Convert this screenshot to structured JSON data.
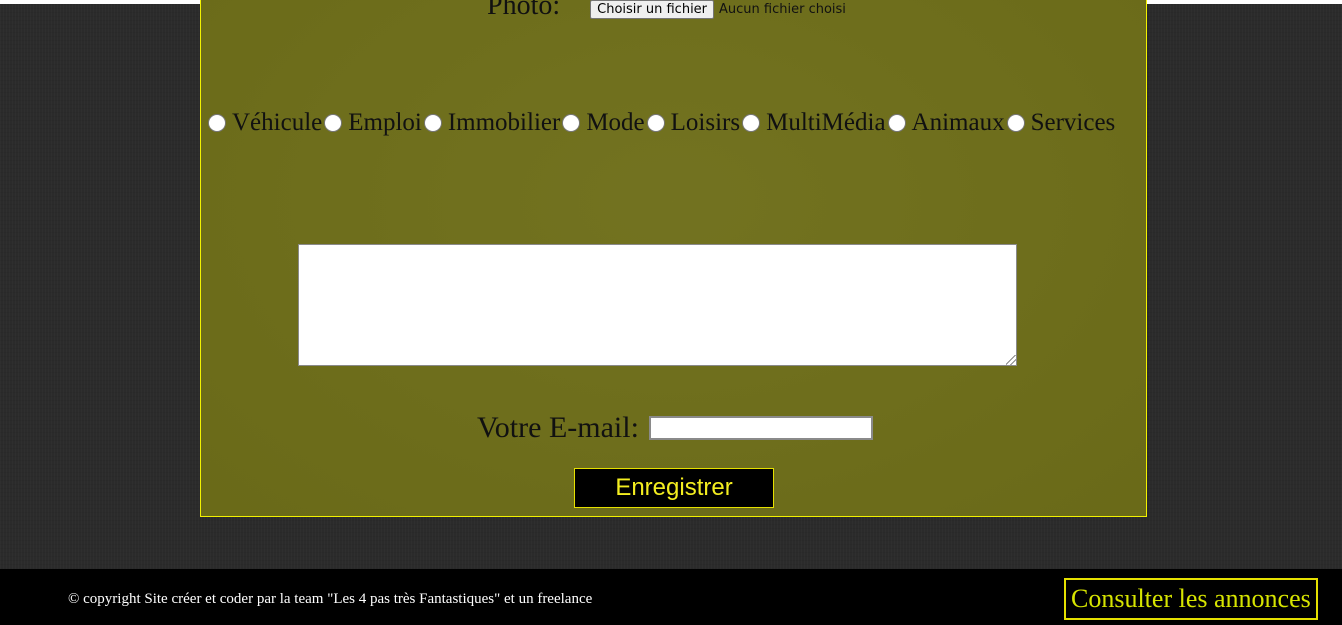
{
  "form": {
    "photo": {
      "label": "Photo:",
      "button_label": "Choisir un fichier",
      "status_text": "Aucun fichier choisi"
    },
    "categories": [
      {
        "label": "Véhicule"
      },
      {
        "label": "Emploi"
      },
      {
        "label": "Immobilier"
      },
      {
        "label": "Mode"
      },
      {
        "label": "Loisirs"
      },
      {
        "label": "MultiMédia"
      },
      {
        "label": "Animaux"
      },
      {
        "label": "Services"
      }
    ],
    "description": {
      "value": ""
    },
    "email": {
      "label": "Votre E-mail:",
      "value": ""
    },
    "submit_label": "Enregistrer"
  },
  "footer": {
    "copyright": "© copyright Site créer et coder par la team \"Les 4 pas très Fantastiques\" et un freelance",
    "consult_link": "Consulter les annonces"
  },
  "colors": {
    "panel_background": "#6e6e19",
    "accent_yellow": "#f2f200",
    "page_background": "#2b2b2b",
    "footer_background": "#000000"
  }
}
